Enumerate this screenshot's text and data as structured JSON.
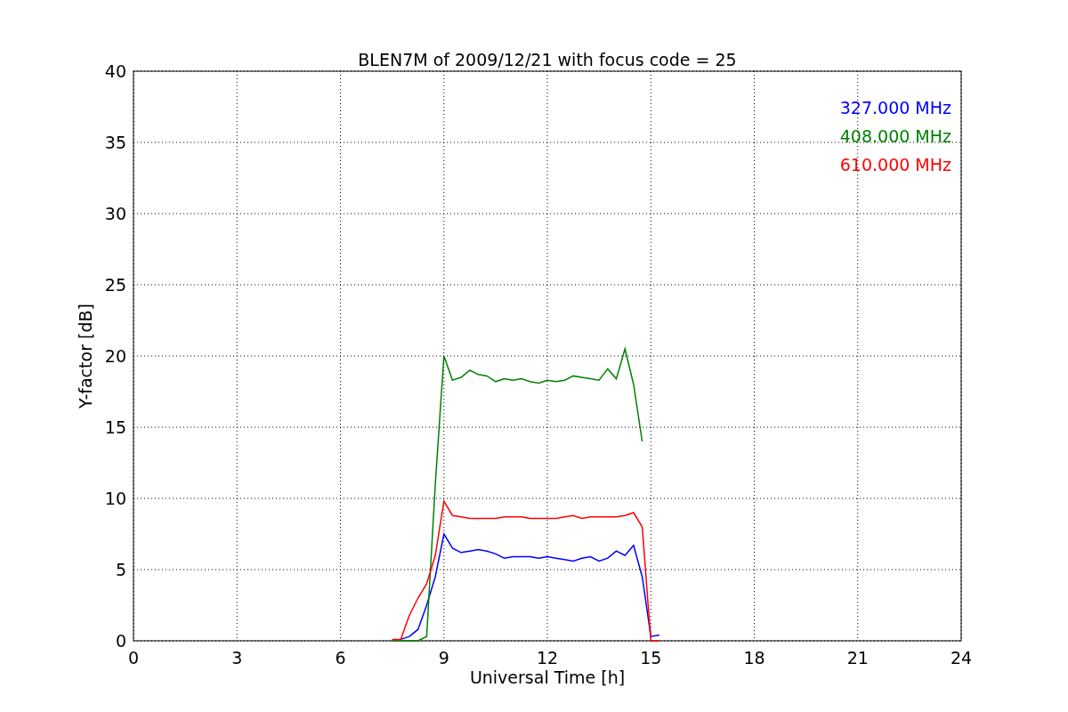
{
  "figure": {
    "chart_data": {
      "type": "line",
      "title": "BLEN7M of 2009/12/21 with focus code = 25",
      "xlabel": "Universal Time [h]",
      "ylabel": "Y-factor [dB]",
      "x": [
        7.5,
        7.75,
        8,
        8.25,
        8.5,
        8.75,
        9,
        9.25,
        9.5,
        9.75,
        10,
        10.25,
        10.5,
        10.75,
        11,
        11.25,
        11.5,
        11.75,
        12,
        12.25,
        12.5,
        12.75,
        13,
        13.25,
        13.5,
        13.75,
        14,
        14.25,
        14.5,
        14.75,
        15,
        15.25
      ],
      "series": [
        {
          "name": "327.000 MHz",
          "color": "#0000ff",
          "values": [
            null,
            0.1,
            0.3,
            0.8,
            2.5,
            4.5,
            7.5,
            6.5,
            6.2,
            6.3,
            6.4,
            6.3,
            6.1,
            5.8,
            5.9,
            5.9,
            5.9,
            5.8,
            5.9,
            5.8,
            5.7,
            5.6,
            5.8,
            5.9,
            5.6,
            5.8,
            6.3,
            6.0,
            6.7,
            4.5,
            0.3,
            0.4
          ]
        },
        {
          "name": "408.000 MHz",
          "color": "#008000",
          "values": [
            0,
            0,
            0,
            0,
            0.3,
            11,
            20,
            18.3,
            18.5,
            19,
            18.7,
            18.6,
            18.2,
            18.4,
            18.3,
            18.4,
            18.2,
            18.1,
            18.3,
            18.2,
            18.3,
            18.6,
            18.5,
            18.4,
            18.3,
            19.1,
            18.4,
            20.5,
            18,
            14,
            null,
            null
          ]
        },
        {
          "name": "610.000 MHz",
          "color": "#ff0000",
          "values": [
            0.1,
            0.1,
            1.8,
            3,
            4,
            6,
            9.8,
            8.8,
            8.7,
            8.6,
            8.6,
            8.6,
            8.6,
            8.7,
            8.7,
            8.7,
            8.6,
            8.6,
            8.6,
            8.6,
            8.7,
            8.8,
            8.6,
            8.7,
            8.7,
            8.7,
            8.7,
            8.8,
            9.0,
            8.0,
            0,
            0
          ]
        }
      ],
      "grid": true,
      "xlim": [
        0,
        24
      ],
      "ylim": [
        0,
        40
      ],
      "xticks": [
        0,
        3,
        6,
        9,
        12,
        15,
        18,
        21,
        24
      ],
      "yticks": [
        0,
        5,
        10,
        15,
        20,
        25,
        30,
        35,
        40
      ]
    }
  }
}
